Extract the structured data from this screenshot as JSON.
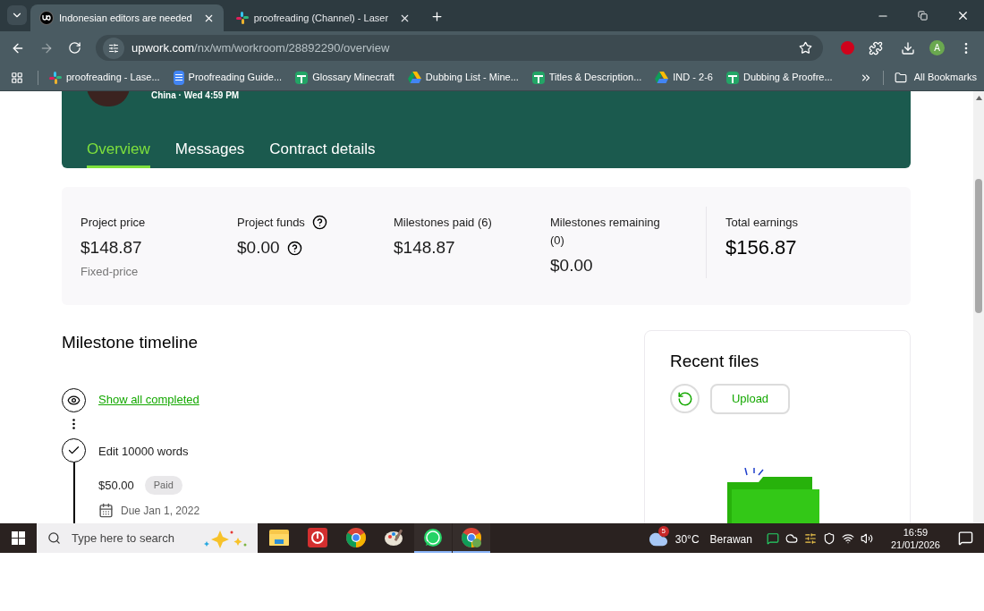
{
  "browser": {
    "tabs": [
      {
        "title": "Indonesian editors are needed",
        "kind": "upwork",
        "selected": true
      },
      {
        "title": "proofreading (Channel) - Laser",
        "kind": "slack",
        "selected": false
      }
    ],
    "url_host": "upwork.com",
    "url_path": "/nx/wm/workroom/28892290/overview",
    "profile_initial": "A",
    "bookmarks": [
      {
        "label": "proofreading - Lase...",
        "kind": "slack"
      },
      {
        "label": "Proofreading Guide...",
        "kind": "docs"
      },
      {
        "label": "Glossary Minecraft",
        "kind": "sheets"
      },
      {
        "label": "Dubbing List - Mine...",
        "kind": "drive"
      },
      {
        "label": "Titles & Description...",
        "kind": "sheets"
      },
      {
        "label": "IND - 2-6",
        "kind": "drive"
      },
      {
        "label": "Dubbing & Proofre...",
        "kind": "sheets"
      }
    ],
    "all_bookmarks": "All Bookmarks"
  },
  "header": {
    "client_meta": "China · Wed 4:59 PM",
    "tabs": [
      {
        "label": "Overview",
        "selected": true
      },
      {
        "label": "Messages",
        "selected": false
      },
      {
        "label": "Contract details",
        "selected": false
      }
    ]
  },
  "stats": [
    {
      "label": "Project price",
      "value": "$148.87",
      "sub": "Fixed-price",
      "label_help": false,
      "value_help": false,
      "emphasis": false
    },
    {
      "label": "Project funds",
      "value": "$0.00",
      "label_help": true,
      "value_help": true,
      "emphasis": false
    },
    {
      "label": "Milestones paid (6)",
      "value": "$148.87",
      "label_help": false,
      "value_help": false,
      "emphasis": false
    },
    {
      "label": "Milestones remaining (0)",
      "value": "$0.00",
      "label_help": false,
      "value_help": false,
      "emphasis": false
    },
    {
      "label": "Total earnings",
      "value": "$156.87",
      "label_help": false,
      "value_help": false,
      "emphasis": true
    }
  ],
  "timeline": {
    "title": "Milestone timeline",
    "show_all": "Show all completed",
    "milestones": [
      {
        "title": "Edit 10000 words",
        "amount": "$50.00",
        "status": "Paid",
        "due": "Due Jan 1, 2022"
      }
    ]
  },
  "recent_files": {
    "title": "Recent files",
    "upload": "Upload"
  },
  "taskbar": {
    "search_placeholder": "Type here to search",
    "apps": [
      {
        "kind": "explorer",
        "running": false
      },
      {
        "kind": "opera",
        "running": false
      },
      {
        "kind": "chrome",
        "running": false
      },
      {
        "kind": "paint",
        "running": false
      },
      {
        "kind": "whatsapp",
        "running": true
      },
      {
        "kind": "chrome-profile",
        "running": true
      }
    ],
    "weather_badge": "5",
    "temperature": "30°C",
    "condition": "Berawan",
    "time": "16:59",
    "date": "21/01/2026"
  }
}
